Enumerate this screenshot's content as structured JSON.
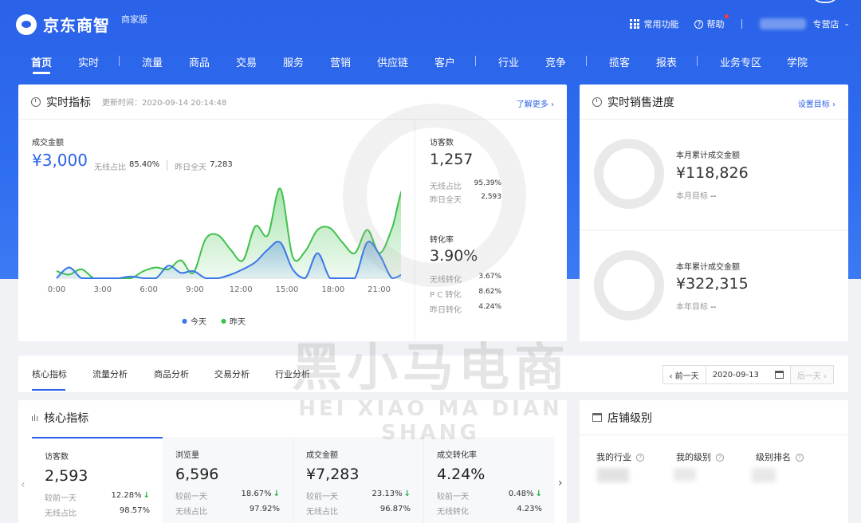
{
  "header": {
    "logo_text": "京东商智",
    "edition": "商家版",
    "common_functions": "常用功能",
    "help": "帮助",
    "shop": "专营店"
  },
  "nav": [
    {
      "label": "首页"
    },
    {
      "label": "实时"
    },
    {
      "label": "流量"
    },
    {
      "label": "商品"
    },
    {
      "label": "交易"
    },
    {
      "label": "服务"
    },
    {
      "label": "营销"
    },
    {
      "label": "供应链"
    },
    {
      "label": "客户"
    },
    {
      "label": "行业"
    },
    {
      "label": "竞争"
    },
    {
      "label": "揽客"
    },
    {
      "label": "报表"
    },
    {
      "label": "业务专区"
    },
    {
      "label": "学院"
    }
  ],
  "realtime": {
    "title": "实时指标",
    "update_time": "更新时间：2020-09-14 20:14:48",
    "learn_more": "了解更多",
    "sales_label": "成交金额",
    "sales_value": "¥3,000",
    "wireless_ratio_label": "无线占比",
    "wireless_ratio": "85.40%",
    "yesterday_label": "昨日全天",
    "yesterday_value": "7,283",
    "visitors_label": "访客数",
    "visitors_value": "1,257",
    "visitors_wireless_label": "无线占比",
    "visitors_wireless": "95.39%",
    "visitors_yesterday_label": "昨日全天",
    "visitors_yesterday": "2,593",
    "conv_label": "转化率",
    "conv_value": "3.90%",
    "conv_wireless_label": "无线转化",
    "conv_wireless": "3.67%",
    "conv_pc_label": "P C 转化",
    "conv_pc": "8.62%",
    "conv_yesterday_label": "昨日转化",
    "conv_yesterday": "4.24%"
  },
  "chart_data": {
    "type": "area",
    "x_ticks": [
      "0:00",
      "3:00",
      "6:00",
      "9:00",
      "12:00",
      "15:00",
      "18:00",
      "21:00"
    ],
    "series": [
      {
        "name": "今天",
        "color": "#3a78e8",
        "values": [
          0,
          6,
          0,
          0,
          0,
          0,
          1,
          0,
          0,
          7,
          3,
          4,
          0,
          0,
          2,
          5,
          9,
          16,
          20,
          5,
          0,
          14,
          0,
          0,
          0,
          20,
          13,
          0,
          3,
          8
        ]
      },
      {
        "name": "昨天",
        "color": "#3fc24c",
        "values": [
          4,
          2,
          5,
          0,
          0,
          0,
          0,
          4,
          6,
          5,
          10,
          3,
          22,
          24,
          16,
          10,
          29,
          24,
          50,
          12,
          15,
          27,
          28,
          20,
          14,
          27,
          14,
          28,
          50,
          14
        ]
      }
    ]
  },
  "sales_progress": {
    "title": "实时销售进度",
    "set_target": "设置目标",
    "month_label": "本月累计成交金额",
    "month_value": "¥118,826",
    "month_target_label": "本月目标",
    "month_target": "--",
    "year_label": "本年累计成交金额",
    "year_value": "¥322,315",
    "year_target_label": "本年目标",
    "year_target": "--"
  },
  "tabs": [
    {
      "label": "核心指标"
    },
    {
      "label": "流量分析"
    },
    {
      "label": "商品分析"
    },
    {
      "label": "交易分析"
    },
    {
      "label": "行业分析"
    }
  ],
  "date_ctrl": {
    "prev": "‹ 前一天",
    "date": "2020-09-13",
    "next": "后一天 ›"
  },
  "core": {
    "title": "核心指标",
    "metrics": [
      {
        "label": "访客数",
        "value": "2,593",
        "cmp_label": "较前一天",
        "cmp": "12.28%",
        "ratio_label": "无线占比",
        "ratio": "98.57%"
      },
      {
        "label": "浏览量",
        "value": "6,596",
        "cmp_label": "较前一天",
        "cmp": "18.67%",
        "ratio_label": "无线占比",
        "ratio": "97.92%"
      },
      {
        "label": "成交金额",
        "value": "¥7,283",
        "cmp_label": "较前一天",
        "cmp": "23.13%",
        "ratio_label": "无线占比",
        "ratio": "96.87%"
      },
      {
        "label": "成交转化率",
        "value": "4.24%",
        "cmp_label": "较前一天",
        "cmp": "0.48%",
        "ratio_label": "无线转化",
        "ratio": "4.23%"
      }
    ]
  },
  "shop_level": {
    "title": "店铺级别",
    "industry": "我的行业",
    "level": "我的级别",
    "rank": "级别排名"
  },
  "watermark": {
    "cn": "黑小马电商",
    "en": "HEI XIAO MA DIAN SHANG"
  }
}
